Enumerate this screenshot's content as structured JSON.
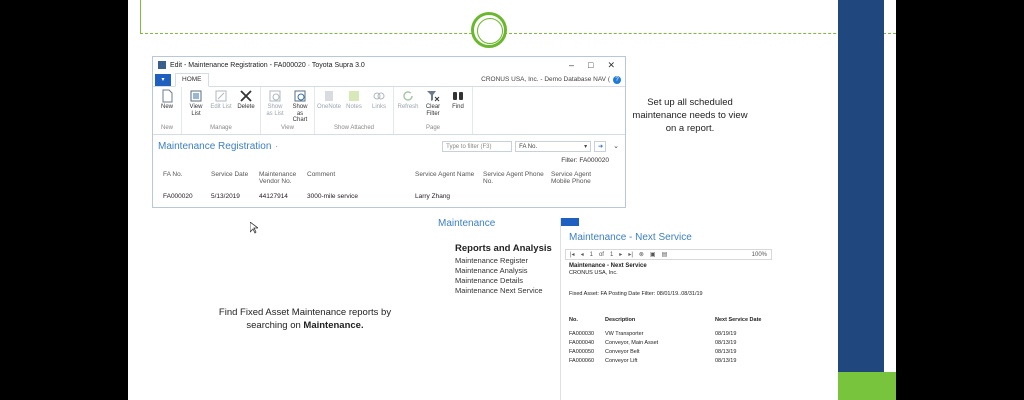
{
  "window": {
    "title": "Edit - Maintenance Registration - FA000020 · Toyota Supra 3.0",
    "file_tab": "",
    "home_tab": "HOME",
    "company": "CRONUS USA, Inc. - Demo Database NAV (",
    "help_glyph": "?",
    "controls": [
      "–",
      "□",
      "✕"
    ]
  },
  "ribbon": {
    "groups": [
      {
        "name": "New",
        "buttons": [
          {
            "label": "New",
            "icon": "new-document-icon",
            "enabled": true
          }
        ]
      },
      {
        "name": "Manage",
        "buttons": [
          {
            "label": "View List",
            "icon": "view-list-icon",
            "enabled": true
          },
          {
            "label": "Edit List",
            "icon": "edit-list-icon",
            "enabled": false
          },
          {
            "label": "Delete",
            "icon": "delete-icon",
            "enabled": true
          }
        ]
      },
      {
        "name": "View",
        "buttons": [
          {
            "label": "Show as List",
            "icon": "show-list-icon",
            "enabled": false
          },
          {
            "label": "Show as Chart",
            "icon": "chart-icon",
            "enabled": true
          }
        ]
      },
      {
        "name": "Show Attached",
        "buttons": [
          {
            "label": "OneNote",
            "icon": "onenote-icon",
            "enabled": false
          },
          {
            "label": "Notes",
            "icon": "notes-icon",
            "enabled": false
          },
          {
            "label": "Links",
            "icon": "links-icon",
            "enabled": false
          }
        ]
      },
      {
        "name": "Page",
        "buttons": [
          {
            "label": "Refresh",
            "icon": "refresh-icon",
            "enabled": false
          },
          {
            "label": "Clear Filter",
            "icon": "clear-filter-icon",
            "enabled": true
          },
          {
            "label": "Find",
            "icon": "binoculars-icon",
            "enabled": true
          }
        ]
      }
    ]
  },
  "page": {
    "title": "Maintenance Registration",
    "title_dot": "·",
    "filter_placeholder": "Type to filter (F3)",
    "filter_field": "FA No.",
    "filter_info": "Filter: FA000020",
    "columns": [
      "FA No.",
      "Service Date",
      "Maintenance Vendor No.",
      "Comment",
      "Service Agent Name",
      "Service Agent Phone No.",
      "Service Agent Mobile Phone"
    ],
    "rows": [
      [
        "FA000020",
        "5/13/2019",
        "44127914",
        "3000-mile service",
        "Larry Zhang",
        "",
        ""
      ]
    ]
  },
  "notes": {
    "right": "Set up all scheduled maintenance needs to view on a report.",
    "left_prefix": "Find Fixed Asset Maintenance reports by searching on",
    "left_bold": "Maintenance."
  },
  "search": {
    "title": "Maintenance",
    "heading": "Reports and Analysis",
    "items": [
      "Maintenance Register",
      "Maintenance Analysis",
      "Maintenance Details",
      "Maintenance Next Service"
    ]
  },
  "report": {
    "window_title": "Maintenance - Next Service",
    "page_current": "1",
    "page_of": "of",
    "page_total": "1",
    "zoom": "100%",
    "body_title": "Maintenance - Next Service",
    "company": "CRONUS USA, Inc.",
    "filter": "Fixed Asset: FA Posting Date Filter: 08/01/19..08/31/19",
    "columns": [
      "No.",
      "Description",
      "Next Service Date"
    ],
    "rows": [
      [
        "FA000030",
        "VW Transporter",
        "08/19/19"
      ],
      [
        "FA000040",
        "Conveyor, Main Asset",
        "08/13/19"
      ],
      [
        "FA000050",
        "Conveyor Belt",
        "08/13/19"
      ],
      [
        "FA000060",
        "Conveyor Lift",
        "08/13/19"
      ]
    ]
  },
  "colors": {
    "accent_green": "#78c43c",
    "navy": "#21487e",
    "link_blue": "#3b7fc4"
  }
}
